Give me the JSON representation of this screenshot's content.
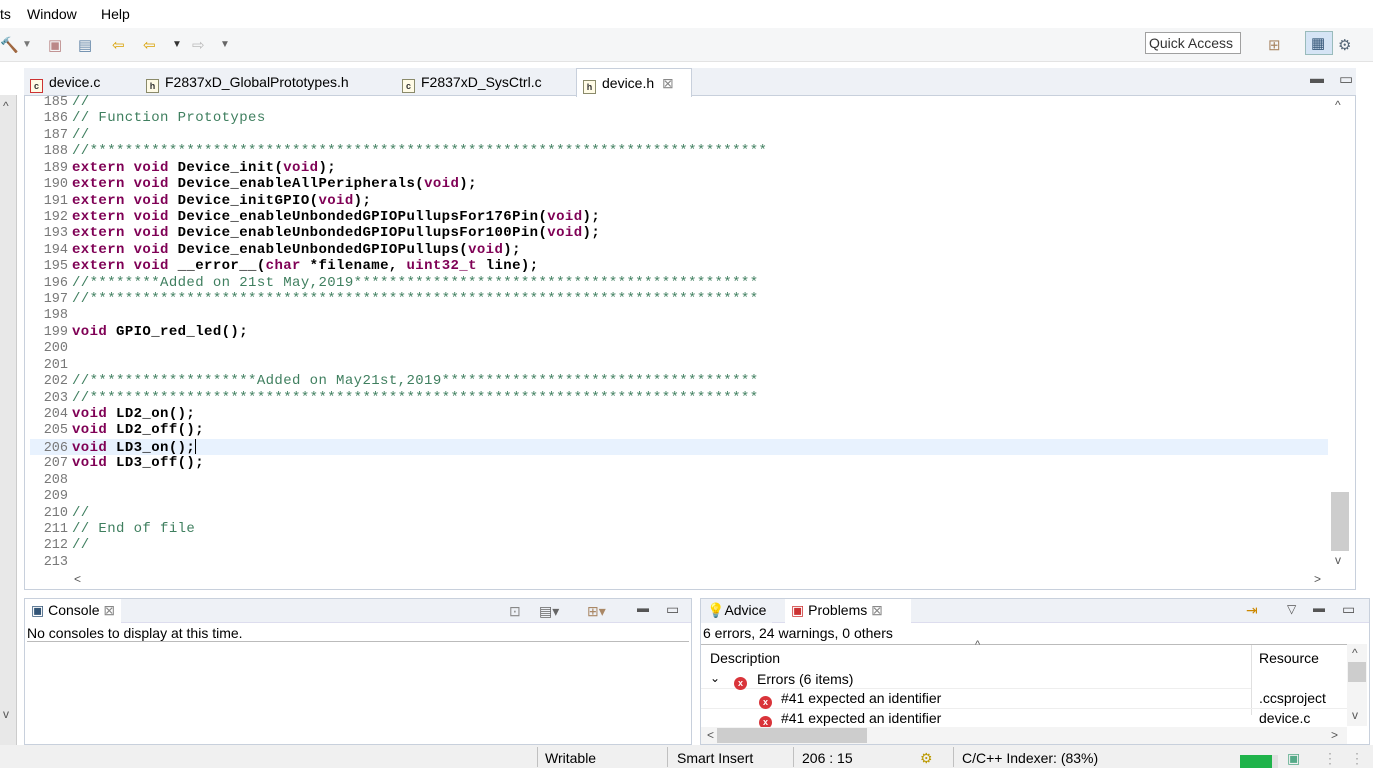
{
  "menu": {
    "items": [
      "ts",
      "Window",
      "Help"
    ]
  },
  "toolbar": {
    "quick_access": "Quick Access"
  },
  "tabs": [
    {
      "label": "device.c",
      "icon": "c-file-error-icon"
    },
    {
      "label": "F2837xD_GlobalPrototypes.h",
      "icon": "h-file-icon"
    },
    {
      "label": "F2837xD_SysCtrl.c",
      "icon": "c-file-icon"
    },
    {
      "label": "device.h",
      "icon": "h-file-icon",
      "active": true,
      "close": "⊠"
    }
  ],
  "editor": {
    "current_line": 206,
    "lines": [
      {
        "n": "185",
        "t": [
          [
            "cm",
            "//"
          ]
        ]
      },
      {
        "n": "186",
        "t": [
          [
            "cm",
            "// Function Prototypes"
          ]
        ]
      },
      {
        "n": "187",
        "t": [
          [
            "cm",
            "//"
          ]
        ]
      },
      {
        "n": "188",
        "t": [
          [
            "cm",
            "//*****************************************************************************"
          ]
        ]
      },
      {
        "n": "189",
        "t": [
          [
            "kw",
            "extern void "
          ],
          [
            "id",
            "Device_init("
          ],
          [
            "kw",
            "void"
          ],
          [
            "pn",
            ");"
          ]
        ]
      },
      {
        "n": "190",
        "t": [
          [
            "kw",
            "extern void "
          ],
          [
            "id",
            "Device_enableAllPeripherals("
          ],
          [
            "kw",
            "void"
          ],
          [
            "pn",
            ");"
          ]
        ]
      },
      {
        "n": "191",
        "t": [
          [
            "kw",
            "extern void "
          ],
          [
            "id",
            "Device_initGPIO("
          ],
          [
            "kw",
            "void"
          ],
          [
            "pn",
            ");"
          ]
        ]
      },
      {
        "n": "192",
        "t": [
          [
            "kw",
            "extern void "
          ],
          [
            "id",
            "Device_enableUnbondedGPIOPullupsFor176Pin("
          ],
          [
            "kw",
            "void"
          ],
          [
            "pn",
            ");"
          ]
        ]
      },
      {
        "n": "193",
        "t": [
          [
            "kw",
            "extern void "
          ],
          [
            "id",
            "Device_enableUnbondedGPIOPullupsFor100Pin("
          ],
          [
            "kw",
            "void"
          ],
          [
            "pn",
            ");"
          ]
        ]
      },
      {
        "n": "194",
        "t": [
          [
            "kw",
            "extern void "
          ],
          [
            "id",
            "Device_enableUnbondedGPIOPullups("
          ],
          [
            "kw",
            "void"
          ],
          [
            "pn",
            ");"
          ]
        ]
      },
      {
        "n": "195",
        "t": [
          [
            "kw",
            "extern void "
          ],
          [
            "id",
            "__error__("
          ],
          [
            "kw",
            "char"
          ],
          [
            "id",
            " *filename, "
          ],
          [
            "kw",
            "uint32_t"
          ],
          [
            "id",
            " line);"
          ]
        ]
      },
      {
        "n": "196",
        "t": [
          [
            "cm",
            "//********Added on 21st May,2019**********************************************"
          ]
        ]
      },
      {
        "n": "197",
        "t": [
          [
            "cm",
            "//****************************************************************************"
          ]
        ]
      },
      {
        "n": "198",
        "t": []
      },
      {
        "n": "199",
        "t": [
          [
            "kw",
            "void "
          ],
          [
            "id",
            "GPIO_red_led();"
          ]
        ]
      },
      {
        "n": "200",
        "t": []
      },
      {
        "n": "201",
        "t": []
      },
      {
        "n": "202",
        "t": [
          [
            "cm",
            "//*******************Added on May21st,2019************************************"
          ]
        ]
      },
      {
        "n": "203",
        "t": [
          [
            "cm",
            "//****************************************************************************"
          ]
        ]
      },
      {
        "n": "204",
        "t": [
          [
            "kw",
            "void "
          ],
          [
            "id",
            "LD2_on();"
          ]
        ]
      },
      {
        "n": "205",
        "t": [
          [
            "kw",
            "void "
          ],
          [
            "id",
            "LD2_off();"
          ]
        ]
      },
      {
        "n": "206",
        "t": [
          [
            "kw",
            "void "
          ],
          [
            "id",
            "LD3_on();"
          ]
        ]
      },
      {
        "n": "207",
        "t": [
          [
            "kw",
            "void "
          ],
          [
            "id",
            "LD3_off();"
          ]
        ]
      },
      {
        "n": "208",
        "t": []
      },
      {
        "n": "209",
        "t": []
      },
      {
        "n": "210",
        "t": [
          [
            "cm",
            "//"
          ]
        ]
      },
      {
        "n": "211",
        "t": [
          [
            "cm",
            "// End of file"
          ]
        ]
      },
      {
        "n": "212",
        "t": [
          [
            "cm",
            "//"
          ]
        ]
      },
      {
        "n": "213",
        "t": []
      }
    ]
  },
  "console": {
    "tab": "Console",
    "close": "⊠",
    "message": "No consoles to display at this time."
  },
  "problems": {
    "advice_tab": "Advice",
    "tab": "Problems",
    "close": "⊠",
    "summary": "6 errors, 24 warnings, 0 others",
    "columns": [
      "Description",
      "Resource"
    ],
    "group": "Errors (6 items)",
    "rows": [
      {
        "description": "#41 expected an identifier",
        "resource": ".ccsproject"
      },
      {
        "description": "#41 expected an identifier",
        "resource": "device.c"
      }
    ]
  },
  "status": {
    "mode": "Writable",
    "insert": "Smart Insert",
    "position": "206 : 15",
    "indexer": "C/C++ Indexer: (83%)",
    "indexer_progress": 83
  },
  "colors": {
    "keyword": "#7f0055",
    "comment": "#3f7f5f",
    "current_line": "#e8f2fe",
    "error": "#d9343a",
    "progress": "#1fb34a"
  }
}
